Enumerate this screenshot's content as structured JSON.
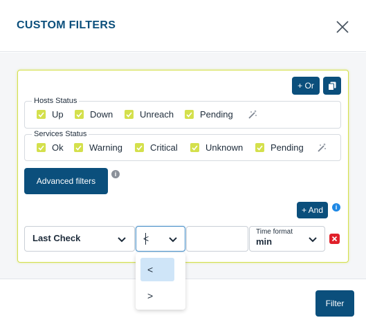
{
  "dialog": {
    "title": "CUSTOM FILTERS"
  },
  "toolbar": {
    "or_label": "+ Or",
    "and_label": "+ And"
  },
  "hosts_status": {
    "legend": "Hosts Status",
    "options": [
      "Up",
      "Down",
      "Unreach",
      "Pending"
    ]
  },
  "services_status": {
    "legend": "Services Status",
    "options": [
      "Ok",
      "Warning",
      "Critical",
      "Unknown",
      "Pending"
    ]
  },
  "advanced": {
    "label": "Advanced filters",
    "info": "i"
  },
  "rule": {
    "field": "Last Check",
    "operator": "<",
    "value": "",
    "time_format_label": "Time format",
    "time_format_value": "min"
  },
  "operator_options": [
    "<",
    ">"
  ],
  "footer": {
    "filter_label": "Filter"
  },
  "colors": {
    "primary": "#0b4f7c",
    "checkbox": "#d4e04c",
    "remove": "#e0202a",
    "info": "#1e88e5"
  }
}
